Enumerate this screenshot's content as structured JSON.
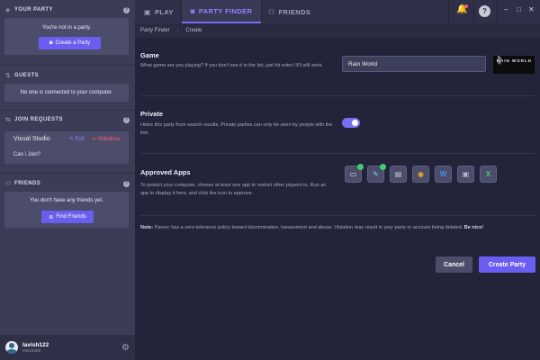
{
  "sidebar": {
    "party": {
      "title": "YOUR PARTY",
      "message": "You're not in a party.",
      "button": "Create a Party"
    },
    "guests": {
      "title": "GUESTS",
      "message": "No one is connected to your computer."
    },
    "requests": {
      "title": "JOIN REQUESTS",
      "item": {
        "name": "Visual Studio",
        "edit": "Edit",
        "withdraw": "Withdraw",
        "message": "Can i Join?"
      }
    },
    "friends": {
      "title": "FRIENDS",
      "message": "You don't have any friends yet.",
      "button": "Find Friends"
    },
    "user": {
      "name": "lavish122",
      "tag": "#5016389"
    }
  },
  "topbar": {
    "tabs": [
      {
        "label": "PLAY",
        "icon": "gamepad-icon",
        "active": false
      },
      {
        "label": "PARTY FINDER",
        "icon": "controller-icon",
        "active": true
      },
      {
        "label": "FRIENDS",
        "icon": "people-icon",
        "active": false
      }
    ],
    "window_controls": {
      "minimize": "–",
      "maximize": "□",
      "close": "✕"
    }
  },
  "breadcrumb": {
    "parent": "Party Finder",
    "current": "Create"
  },
  "form": {
    "game": {
      "title": "Game",
      "description": "What game are you playing? If you don't see it in the list, just hit enter! It'll still work.",
      "value": "Rain World",
      "thumbnail_text": "RAIN WORLD"
    },
    "private": {
      "title": "Private",
      "description": "Hides this party from search results. Private parties can only be seen by people with the link.",
      "enabled": true
    },
    "apps": {
      "title": "Approved Apps",
      "description": "To protect your computer, choose at least one app to restrict other players to. Run an app to display it here, and click the icon to approve.",
      "items": [
        {
          "icon": "window-app-icon",
          "glyph": "▭",
          "approved": true,
          "color": "#e8e8ee"
        },
        {
          "icon": "paint-app-icon",
          "glyph": "✎",
          "approved": true,
          "color": "#7fd3ff"
        },
        {
          "icon": "document-app-icon",
          "glyph": "▤",
          "approved": false,
          "color": "#c9cbd9"
        },
        {
          "icon": "chrome-app-icon",
          "glyph": "◉",
          "approved": false,
          "color": "#f2b233"
        },
        {
          "icon": "word-app-icon",
          "glyph": "W",
          "approved": false,
          "color": "#4b8cf5"
        },
        {
          "icon": "monitor-app-icon",
          "glyph": "▣",
          "approved": false,
          "color": "#b8bbd0"
        },
        {
          "icon": "excel-app-icon",
          "glyph": "X",
          "approved": false,
          "color": "#3ecf6e"
        }
      ]
    },
    "note": {
      "label": "Note:",
      "text": "Parsec has a zero-tolerance policy toward discrimination, harassment and abuse. Violation may result in your party or account being deleted.",
      "emphasis": "Be nice!"
    },
    "cancel": "Cancel",
    "create": "Create Party"
  },
  "colors": {
    "accent": "#6a5ef0",
    "withdraw": "#ff5b6a",
    "approved": "#3ecf6e"
  }
}
